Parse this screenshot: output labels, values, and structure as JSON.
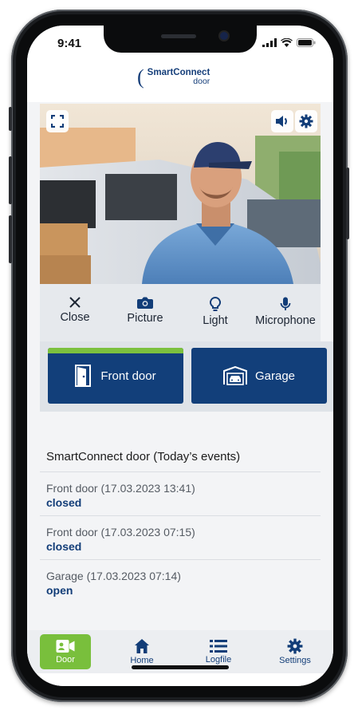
{
  "status_bar": {
    "time": "9:41"
  },
  "header": {
    "logo_line1": "SmartConnect",
    "logo_line2": "door"
  },
  "controls": [
    {
      "label": "Close",
      "icon": "close-icon"
    },
    {
      "label": "Picture",
      "icon": "camera-icon"
    },
    {
      "label": "Light",
      "icon": "lightbulb-icon"
    },
    {
      "label": "Microphone",
      "icon": "microphone-icon"
    }
  ],
  "doors": [
    {
      "label": "Front door",
      "icon": "door-icon",
      "active": true
    },
    {
      "label": "Garage",
      "icon": "garage-icon",
      "active": false
    }
  ],
  "events": {
    "title": "SmartConnect door (Today’s events)",
    "items": [
      {
        "title": "Front door (17.03.2023 13:41)",
        "status": "closed"
      },
      {
        "title": "Front door (17.03.2023 07:15)",
        "status": "closed"
      },
      {
        "title": "Garage (17.03.2023 07:14)",
        "status": "open"
      }
    ]
  },
  "tabbar": [
    {
      "label": "Door",
      "icon": "video-camera-icon",
      "active": true
    },
    {
      "label": "Home",
      "icon": "house-icon",
      "active": false
    },
    {
      "label": "Logfile",
      "icon": "list-icon",
      "active": false
    },
    {
      "label": "Settings",
      "icon": "gear-icon",
      "active": false
    }
  ],
  "colors": {
    "brand_blue": "#123f7a",
    "accent_green": "#79bf3c",
    "panel_bg": "#e6e9ed"
  }
}
